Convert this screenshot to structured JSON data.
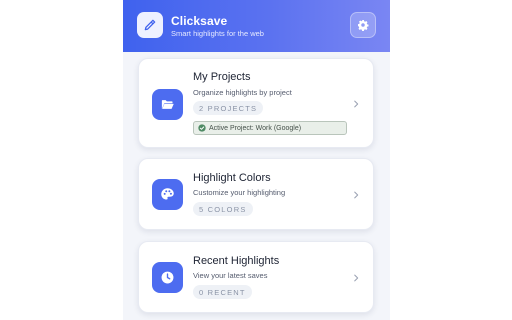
{
  "app": {
    "title": "Clicksave",
    "subtitle": "Smart highlights for the web",
    "logo_icon": "highlighter-pen-icon",
    "settings_icon": "gear-icon"
  },
  "cards": [
    {
      "title": "My Projects",
      "description": "Organize highlights by project",
      "badge": "2 PROJECTS",
      "icon": "folder-open-icon",
      "active_project": "Active Project: Work (Google)"
    },
    {
      "title": "Highlight Colors",
      "description": "Customize your highlighting",
      "badge": "5 COLORS",
      "icon": "palette-icon"
    },
    {
      "title": "Recent Highlights",
      "description": "View your latest saves",
      "badge": "0 RECENT",
      "icon": "clock-icon"
    }
  ],
  "colors": {
    "header_start": "#3f62ee",
    "header_end": "#7a86f3",
    "accent": "#4d6cf0",
    "active_check": "#4f8a64"
  }
}
